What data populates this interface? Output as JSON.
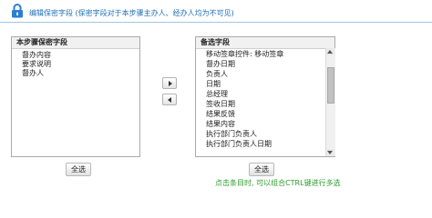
{
  "header": {
    "title": "编辑保密字段 (保密字段对于本步骤主办人、经办人均为不可见)",
    "icon": "lock-icon",
    "color": "#1f6fb6"
  },
  "left_panel": {
    "header": "本步骤保密字段",
    "items": [
      "督办内容",
      "要求说明",
      "督办人"
    ],
    "select_all_label": "全选"
  },
  "right_panel": {
    "header": "备选字段",
    "items": [
      "移动签章控件: 移动签章",
      "督办日期",
      "负责人",
      "日期",
      "总经理",
      "签收日期",
      "结果反馈",
      "结果内容",
      "执行部门负责人",
      "执行部门负责人日期"
    ],
    "select_all_label": "全选"
  },
  "controls": {
    "move_right_icon": "arrow-right-icon",
    "move_left_icon": "arrow-left-icon"
  },
  "hint": {
    "text": "点击条目时, 可以组合CTRL键进行多选",
    "color": "#2e9e2e"
  }
}
